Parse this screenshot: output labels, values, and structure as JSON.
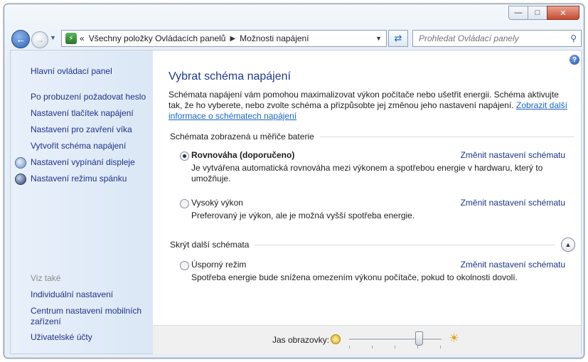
{
  "window": {
    "minimize_icon": "minimize-icon",
    "maximize_icon": "maximize-icon",
    "close_icon": "close-icon"
  },
  "nav": {
    "breadcrumb": [
      "Všechny položky Ovládacích panelů",
      "Možnosti napájení"
    ],
    "breadcrumb_prefix": "«",
    "search_placeholder": "Prohledat Ovládací panely"
  },
  "sidebar": {
    "home": "Hlavní ovládací panel",
    "items": [
      "Po probuzení požadovat heslo",
      "Nastavení tlačítek napájení",
      "Nastavení pro zavření víka",
      "Vytvořit schéma napájení",
      "Nastavení vypínání displeje",
      "Nastavení režimu spánku"
    ],
    "see_also_label": "Viz také",
    "see_also": [
      "Individuální nastavení",
      "Centrum nastavení mobilních zařízení",
      "Uživatelské účty"
    ]
  },
  "main": {
    "title": "Vybrat schéma napájení",
    "intro_text": "Schémata napájení vám pomohou maximalizovat výkon počítače nebo ušetřit energii. Schéma aktivujte tak, že ho vyberete, nebo zvolte schéma a přizpůsobte jej změnou jeho nastavení napájení.",
    "intro_link": "Zobrazit další informace o schématech napájení",
    "group_battery": "Schémata zobrazená u měřiče baterie",
    "group_hidden": "Skrýt další schémata",
    "change_label": "Změnit nastavení schématu",
    "plans": [
      {
        "name": "Rovnováha (doporučeno)",
        "desc": "Je vytvářena automatická rovnováha mezi výkonem a spotřebou energie v hardwaru, který to umožňuje.",
        "selected": true
      },
      {
        "name": "Vysoký výkon",
        "desc": "Preferovaný je výkon, ale je možná vyšší spotřeba energie.",
        "selected": false
      },
      {
        "name": "Úsporný režim",
        "desc": "Spotřeba energie bude snížena omezením výkonu počítače, pokud to okolnosti dovolí.",
        "selected": false
      }
    ]
  },
  "bottom": {
    "brightness_label": "Jas obrazovky:",
    "brightness_level": 0.75
  },
  "colors": {
    "link": "#1e3287",
    "title": "#1e3a8a",
    "sidebar_bg": "#dbe7f6"
  }
}
